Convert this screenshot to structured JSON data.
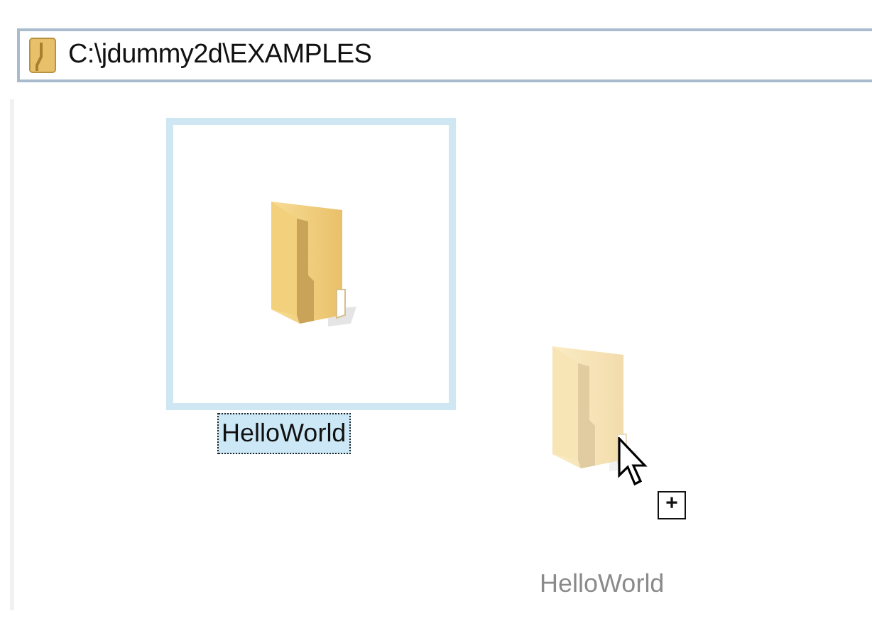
{
  "address_bar": {
    "path": "C:\\jdummy2d\\EXAMPLES"
  },
  "items": [
    {
      "label": "HelloWorld",
      "selected": true
    }
  ],
  "drag_ghost": {
    "label": "HelloWorld",
    "copy_sign": "+"
  }
}
